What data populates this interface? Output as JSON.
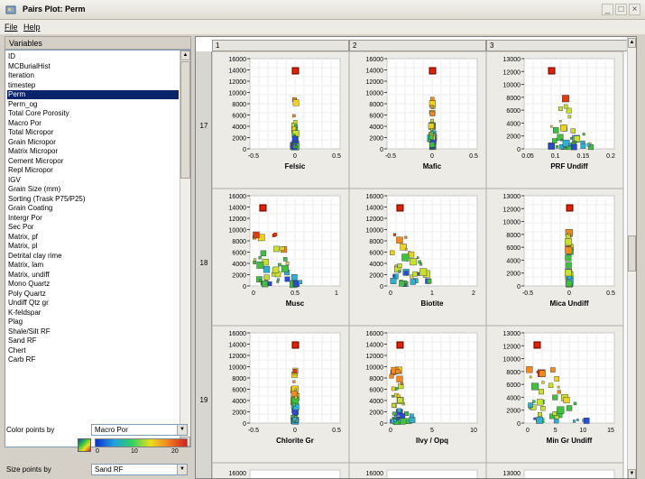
{
  "window": {
    "title": "Pairs Plot:  Perm"
  },
  "menu": {
    "file": "File",
    "help": "Help"
  },
  "variables_panel": {
    "header": "Variables",
    "items": [
      "ID",
      "MCBurialHist",
      "Iteration",
      "timestep",
      "Perm",
      "Perm_og",
      "Total Core Porosity",
      "Macro Por",
      "Total Micropor",
      "Grain Micropor",
      "Matrix Micropor",
      "Cement Micropor",
      "Repl Micropor",
      "IGV",
      "Grain Size (mm)",
      "Sorting (Trask P75/P25)",
      "Grain Coating",
      "Intergr Por",
      "Sec Por",
      "Matrix, pf",
      "Matrix, pl",
      "Detrital clay rime",
      "Matrix, lam",
      "Matrix, undiff",
      "Mono Quartz",
      "Poly Quartz",
      "Undiff Qtz gr",
      "K-feldspar",
      "Plag",
      "Shale/Silt RF",
      "Sand RF",
      "Chert",
      "Carb RF"
    ],
    "selected_index": 4
  },
  "color_points": {
    "label": "Color points by",
    "value": "Macro Por",
    "scale_ticks": [
      "0",
      "10",
      "20"
    ]
  },
  "size_points": {
    "label": "Size points by",
    "value": "Sand RF"
  },
  "grid": {
    "columns": [
      "1",
      "2",
      "3"
    ],
    "rows": [
      "17",
      "18",
      "19"
    ],
    "panels": [
      {
        "xlabel": "Felsic",
        "xticks": [
          "-0.5",
          "0",
          "0.5"
        ],
        "yticks": [
          "16000",
          "14000",
          "12000",
          "10000",
          "8000",
          "6000",
          "4000",
          "2000",
          "0"
        ]
      },
      {
        "xlabel": "Mafic",
        "xticks": [
          "-0.5",
          "0",
          "0.5"
        ],
        "yticks": [
          "16000",
          "14000",
          "12000",
          "10000",
          "8000",
          "6000",
          "4000",
          "2000",
          "0"
        ]
      },
      {
        "xlabel": "PRF Undiff",
        "xticks": [
          "0.05",
          "0.1",
          "0.15",
          "0.2"
        ],
        "yticks": [
          "13000",
          "12000",
          "10000",
          "8000",
          "6000",
          "4000",
          "2000",
          "0"
        ]
      },
      {
        "xlabel": "Musc",
        "xticks": [
          "0",
          "0.5",
          "1"
        ],
        "yticks": [
          "16000",
          "14000",
          "12000",
          "10000",
          "8000",
          "6000",
          "4000",
          "2000",
          "0"
        ]
      },
      {
        "xlabel": "Biotite",
        "xticks": [
          "0",
          "1",
          "2"
        ],
        "yticks": [
          "16000",
          "14000",
          "12000",
          "10000",
          "8000",
          "6000",
          "4000",
          "2000",
          "0"
        ]
      },
      {
        "xlabel": "Mica Undiff",
        "xticks": [
          "-0.5",
          "0",
          "0.5"
        ],
        "yticks": [
          "13000",
          "12000",
          "10000",
          "8000",
          "6000",
          "4000",
          "2000",
          "0"
        ]
      },
      {
        "xlabel": "Chlorite Gr",
        "xticks": [
          "-0.5",
          "0",
          "0.5"
        ],
        "yticks": [
          "16000",
          "14000",
          "12000",
          "10000",
          "8000",
          "6000",
          "4000",
          "2000",
          "0"
        ]
      },
      {
        "xlabel": "Ilvy / Opq",
        "xticks": [
          "0",
          "5",
          "10"
        ],
        "yticks": [
          "16000",
          "14000",
          "12000",
          "10000",
          "8000",
          "6000",
          "4000",
          "2000",
          "0"
        ]
      },
      {
        "xlabel": "Min Gr Undiff",
        "xticks": [
          "0",
          "5",
          "10",
          "15"
        ],
        "yticks": [
          "13000",
          "12000",
          "10000",
          "8000",
          "6000",
          "4000",
          "2000",
          "0"
        ]
      }
    ],
    "partial_row_yticks": [
      "16000",
      "16000",
      "13000"
    ]
  },
  "colors": {
    "selection": "#0a246a",
    "panel_bg": "#ecebe6",
    "plot_bg": "#ffffff",
    "point_high": "#dd2200",
    "point_mid": "#f0d020",
    "point_low": "#2a4cd0"
  }
}
